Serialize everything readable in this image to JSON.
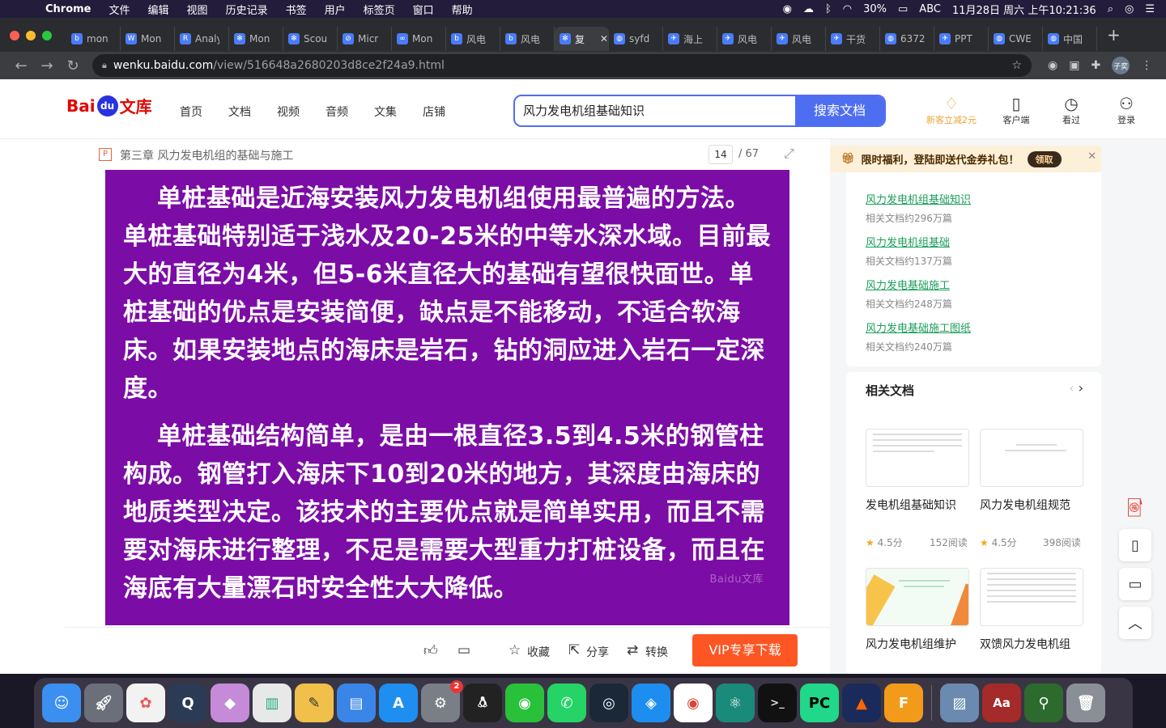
{
  "menubar": {
    "app": "Chrome",
    "items": [
      "文件",
      "编辑",
      "视图",
      "历史记录",
      "书签",
      "用户",
      "标签页",
      "窗口",
      "帮助"
    ],
    "battery": "30%",
    "input_method": "ABC",
    "datetime": "11月28日 周六 上午10:21:36"
  },
  "tabs": [
    {
      "label": "mon",
      "icon": "b"
    },
    {
      "label": "Mon",
      "icon": "W"
    },
    {
      "label": "Analy",
      "icon": "R"
    },
    {
      "label": "Mon",
      "icon": "✻"
    },
    {
      "label": "Scou",
      "icon": "✻"
    },
    {
      "label": "Micr",
      "icon": "⊘"
    },
    {
      "label": "Mon",
      "icon": "∞"
    },
    {
      "label": "风电",
      "icon": "b"
    },
    {
      "label": "风电",
      "icon": "b"
    },
    {
      "label": "复",
      "icon": "✻"
    },
    {
      "label": "syfd",
      "icon": "◍"
    },
    {
      "label": "海上",
      "icon": "✈"
    },
    {
      "label": "风电",
      "icon": "✈"
    },
    {
      "label": "风电",
      "icon": "✈"
    },
    {
      "label": "干货",
      "icon": "✈"
    },
    {
      "label": "6372",
      "icon": "◍"
    },
    {
      "label": "PPT",
      "icon": "✈"
    },
    {
      "label": "CWE",
      "icon": "◍"
    },
    {
      "label": "中国",
      "icon": "◍"
    }
  ],
  "address": {
    "host": "wenku.baidu.com",
    "path": "/view/516648a2680203d8ce2f24a9.html"
  },
  "profile_initials": "子奕",
  "header": {
    "logo_bai": "Bai",
    "logo_du": "du",
    "logo_wenku": "文库",
    "nav": [
      "首页",
      "文档",
      "视频",
      "音频",
      "文集",
      "店铺"
    ],
    "search_value": "风力发电机组基础知识",
    "search_button": "搜索文档",
    "icons": [
      {
        "label": "新客立减2元",
        "glyph": "♢"
      },
      {
        "label": "客户端",
        "glyph": "▯"
      },
      {
        "label": "看过",
        "glyph": "◷"
      },
      {
        "label": "登录",
        "glyph": "⚇"
      }
    ]
  },
  "doc": {
    "type_badge": "P",
    "title": "第三章 风力发电机组的基础与施工",
    "page_current": "14",
    "page_total": "/ 67",
    "paragraph1": "单桩基础是近海安装风力发电机组使用最普遍的方法。单桩基础特别适于浅水及20-25米的中等水深水域。目前最大的直径为4米，但5-6米直径大的基础有望很快面世。单桩基础的优点是安装简便，缺点是不能移动，不适合软海床。如果安装地点的海床是岩石，钻的洞应进入岩石一定深度。",
    "paragraph2": "单桩基础结构简单，是由一根直径3.5到4.5米的钢管柱构成。钢管打入海床下10到20米的地方，其深度由海床的地质类型决定。该技术的主要优点就是简单实用，而且不需要对海床进行整理，不足是需要大型重力打桩设备，而且在海底有大量漂石时安全性大大降低。",
    "watermark": "Baidu文库"
  },
  "actions": {
    "collect": "收藏",
    "share": "分享",
    "convert": "转换",
    "vip_download": "VIP专享下载"
  },
  "promo": {
    "text": "限时福利，登陆即送代金券礼包！",
    "button": "领取"
  },
  "related_searches": [
    {
      "title": "风力发电机组基础知识",
      "count": "相关文档约296万篇"
    },
    {
      "title": "风力发电机组基础",
      "count": "相关文档约137万篇"
    },
    {
      "title": "风力发电基础施工",
      "count": "相关文档约248万篇"
    },
    {
      "title": "风力发电基础施工图纸",
      "count": "相关文档约240万篇"
    }
  ],
  "related_docs": {
    "heading": "相关文档",
    "items": [
      {
        "name": "发电机组基础知识",
        "rating": "4.5分",
        "reads": "152阅读"
      },
      {
        "name": "风力发电机组规范",
        "rating": "4.5分",
        "reads": "398阅读"
      },
      {
        "name": "风力发电机组维护",
        "rating": "",
        "reads": ""
      },
      {
        "name": "双馈风力发电机组",
        "rating": "",
        "reads": ""
      }
    ]
  },
  "dock_badge": "2"
}
